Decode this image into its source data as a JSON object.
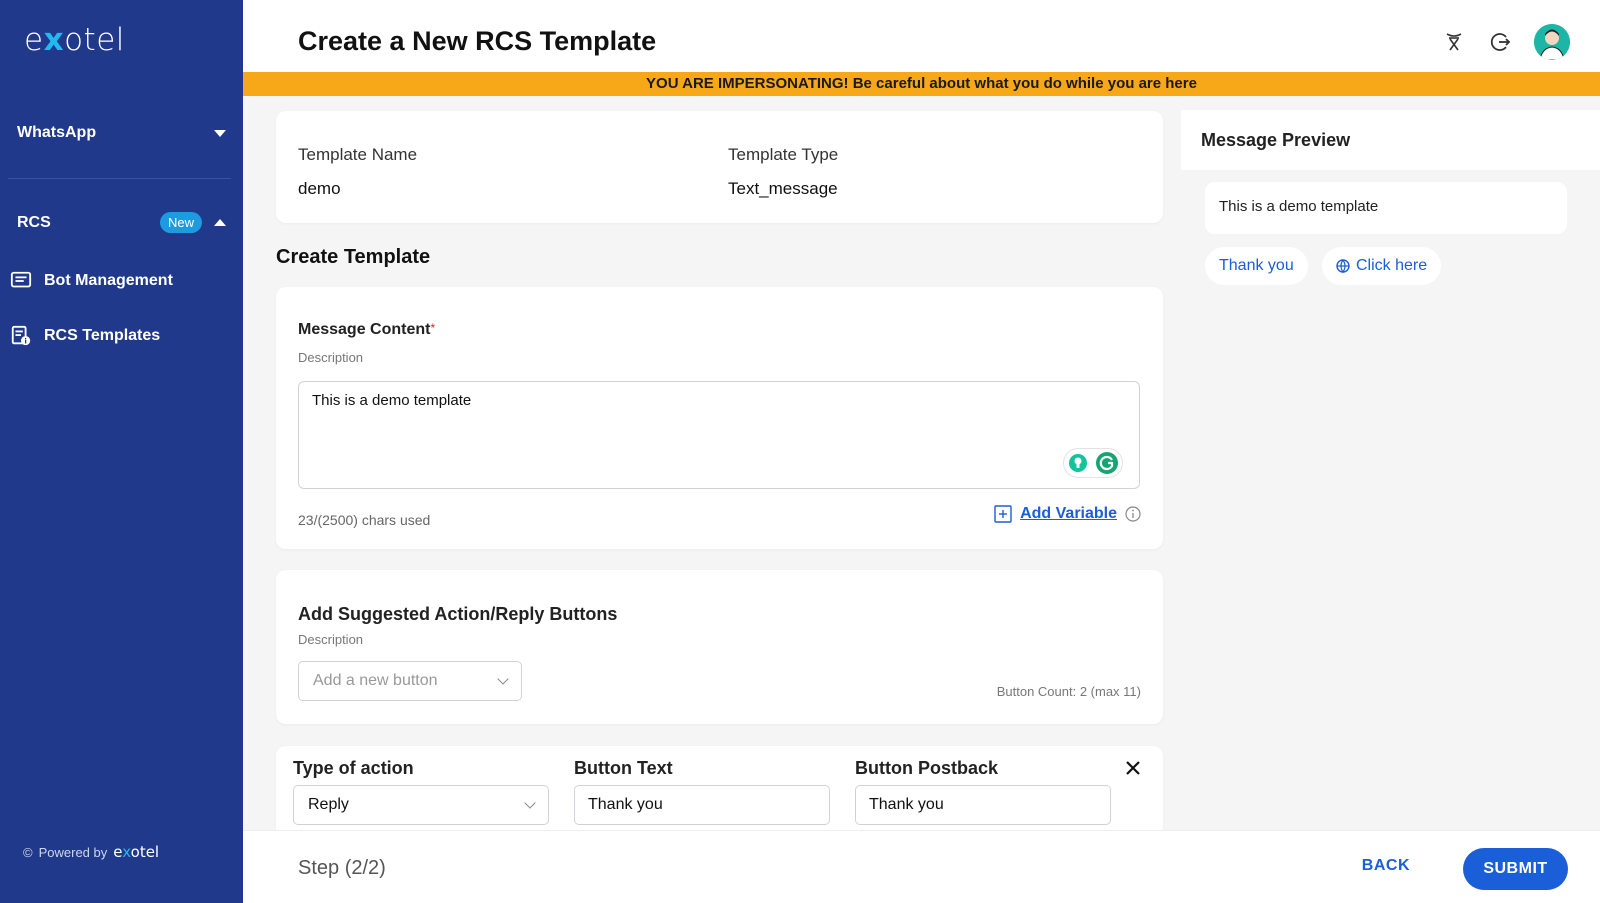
{
  "brand": {
    "logo_pre": "e",
    "logo_x": "x",
    "logo_post": "otel"
  },
  "sidebar": {
    "whatsapp_label": "WhatsApp",
    "rcs_label": "RCS",
    "rcs_badge": "New",
    "items": [
      {
        "label": "Bot Management",
        "icon": "chat-list-icon"
      },
      {
        "label": "RCS Templates",
        "icon": "template-icon"
      }
    ],
    "powered_by": "Powered by",
    "powered_logo_pre": "e",
    "powered_logo_x": "x",
    "powered_logo_post": "otel"
  },
  "header": {
    "title": "Create a New RCS Template",
    "icons": [
      "incognito-icon",
      "logout-icon",
      "avatar"
    ]
  },
  "banner": {
    "text": "YOU ARE IMPERSONATING! Be careful about what you do while you are here"
  },
  "template_info": {
    "name_label": "Template Name",
    "name_value": "demo",
    "type_label": "Template Type",
    "type_value": "Text_message"
  },
  "create_template": {
    "title": "Create Template",
    "message_content_label": "Message Content",
    "required_mark": "*",
    "description": "Description",
    "message_text": "This is a demo template",
    "chars_used": "23/(2500) chars used",
    "add_variable": "Add Variable"
  },
  "buttons_section": {
    "title": "Add Suggested Action/Reply Buttons",
    "description": "Description",
    "select_placeholder": "Add a new button",
    "count_text": "Button Count: 2 (max 11)"
  },
  "button_row": {
    "type_label": "Type of action",
    "type_value": "Reply",
    "text_label": "Button Text",
    "text_value": "Thank you",
    "postback_label": "Button Postback",
    "postback_value": "Thank you"
  },
  "preview": {
    "title": "Message Preview",
    "message": "This is a demo template",
    "chips": [
      "Thank you",
      "Click here"
    ]
  },
  "footer": {
    "step": "Step (2/2)",
    "back": "BACK",
    "submit": "SUBMIT"
  },
  "colors": {
    "sidebar": "#21398a",
    "accent": "#1a5ed8",
    "banner": "#f6a818",
    "badge": "#1e9be0"
  }
}
